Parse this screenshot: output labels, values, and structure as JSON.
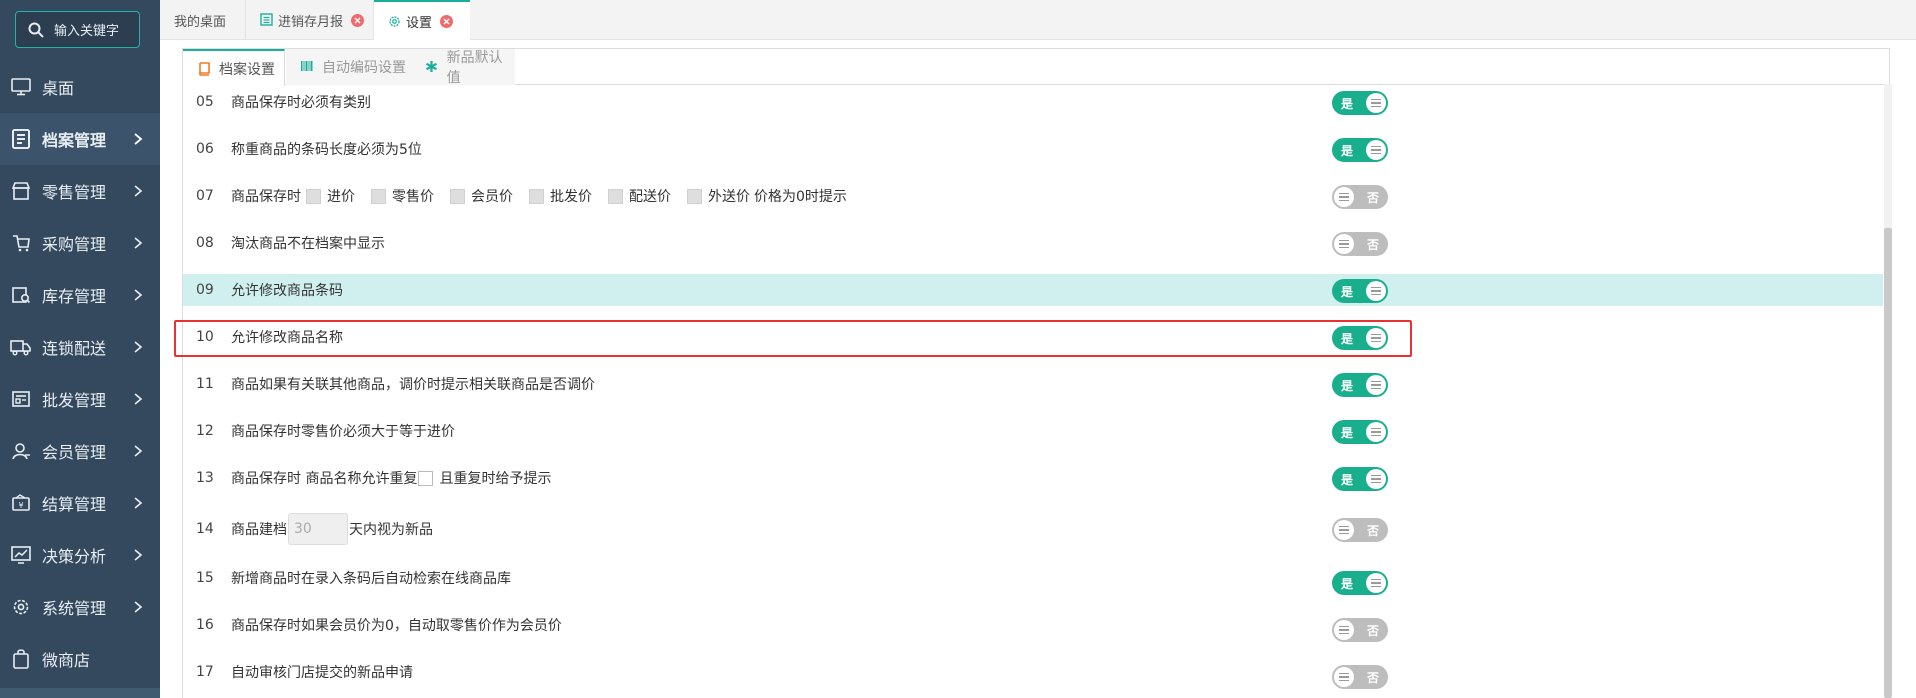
{
  "sidebar": {
    "search_placeholder": "输入关键字",
    "items": [
      {
        "label": "桌面",
        "icon": "monitor-icon",
        "active": false
      },
      {
        "label": "档案管理",
        "icon": "archive-icon",
        "active": true
      },
      {
        "label": "零售管理",
        "icon": "store-icon",
        "active": false
      },
      {
        "label": "采购管理",
        "icon": "purchase-icon",
        "active": false
      },
      {
        "label": "库存管理",
        "icon": "inventory-icon",
        "active": false
      },
      {
        "label": "连锁配送",
        "icon": "truck-icon",
        "active": false
      },
      {
        "label": "批发管理",
        "icon": "wholesale-icon",
        "active": false
      },
      {
        "label": "会员管理",
        "icon": "member-icon",
        "active": false
      },
      {
        "label": "结算管理",
        "icon": "settlement-icon",
        "active": false
      },
      {
        "label": "决策分析",
        "icon": "chart-icon",
        "active": false
      },
      {
        "label": "系统管理",
        "icon": "gear-icon",
        "active": false
      },
      {
        "label": "微商店",
        "icon": "shop-bag-icon",
        "active": false
      }
    ]
  },
  "top_tabs": [
    {
      "label": "我的桌面"
    },
    {
      "label": "进销存月报"
    },
    {
      "label": "设置"
    }
  ],
  "sub_tabs": [
    {
      "label": "档案设置"
    },
    {
      "label": "自动编码设置"
    },
    {
      "label": "新品默认值"
    }
  ],
  "switch_labels": {
    "on": "是",
    "off": "否"
  },
  "rows": [
    {
      "num": "05",
      "text": "商品保存时必须有类别",
      "on": true
    },
    {
      "num": "06",
      "text": "称重商品的条码长度必须为5位",
      "on": true
    },
    {
      "num": "07",
      "prefix": "商品保存时",
      "options": [
        "进价",
        "零售价",
        "会员价",
        "批发价",
        "配送价",
        "外送价"
      ],
      "suffix": "价格为0时提示",
      "on": false
    },
    {
      "num": "08",
      "text": "淘汰商品不在档案中显示",
      "on": false
    },
    {
      "num": "09",
      "text": "允许修改商品条码",
      "on": true
    },
    {
      "num": "10",
      "text": "允许修改商品名称",
      "on": true
    },
    {
      "num": "11",
      "text": "商品如果有关联其他商品，调价时提示相关联商品是否调价",
      "on": true
    },
    {
      "num": "12",
      "text": "商品保存时零售价必须大于等于进价",
      "on": true
    },
    {
      "num": "13",
      "text": "商品保存时 商品名称允许重复",
      "suffix": "且重复时给予提示",
      "on": true
    },
    {
      "num": "14",
      "prefix": "商品建档",
      "days_value": "30",
      "suffix": "天内视为新品",
      "on": false
    },
    {
      "num": "15",
      "text": "新增商品时在录入条码后自动检索在线商品库",
      "on": true
    },
    {
      "num": "16",
      "text": "商品保存时如果会员价为0，自动取零售价作为会员价",
      "on": false
    },
    {
      "num": "17",
      "text": "自动审核门店提交的新品申请",
      "on": false
    }
  ],
  "colors": {
    "accent": "#1aaf8c",
    "sidebar_bg": "#34495e",
    "highlight": "#cff0ef",
    "annotation": "#e83232"
  }
}
